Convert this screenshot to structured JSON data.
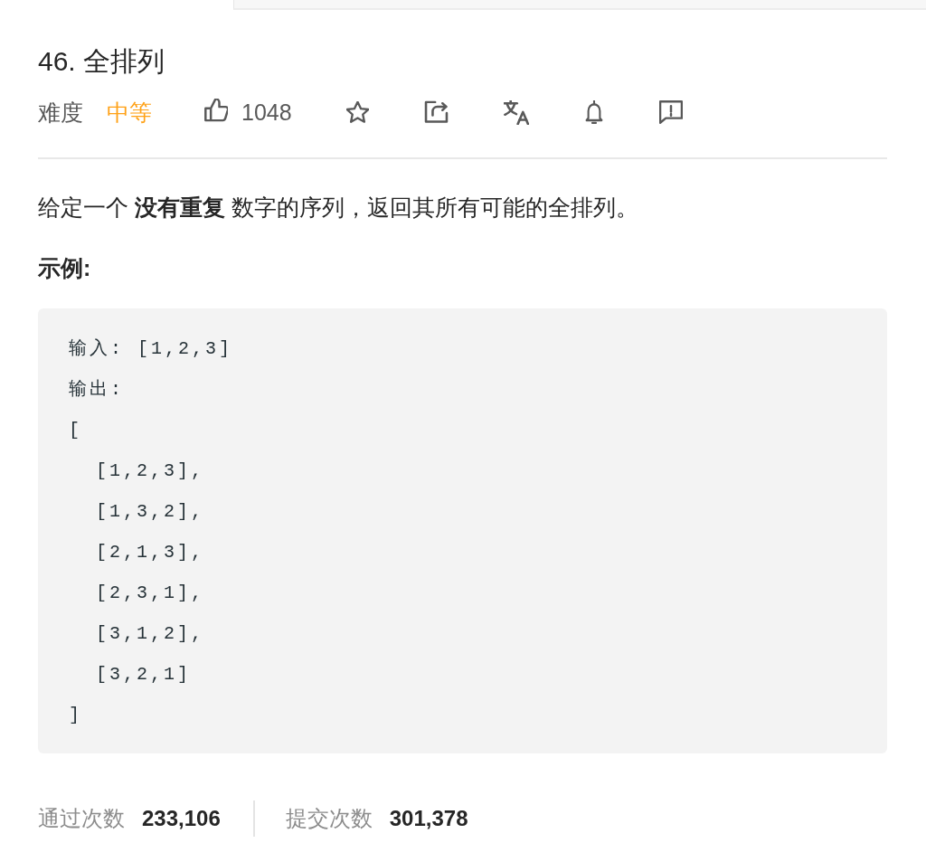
{
  "problem": {
    "title": "46. 全排列",
    "difficulty_label": "难度",
    "difficulty": "中等",
    "likes": "1048"
  },
  "description": "给定一个 **没有重复** 数字的序列，返回其所有可能的全排列。",
  "example": {
    "heading": "示例:",
    "code": [
      "输入: [1,2,3]",
      "输出:",
      "[",
      "  [1,2,3],",
      "  [1,3,2],",
      "  [2,1,3],",
      "  [2,3,1],",
      "  [3,1,2],",
      "  [3,2,1]",
      "]"
    ]
  },
  "stats": [
    {
      "label": "通过次数",
      "value": "233,106"
    },
    {
      "label": "提交次数",
      "value": "301,378"
    }
  ]
}
